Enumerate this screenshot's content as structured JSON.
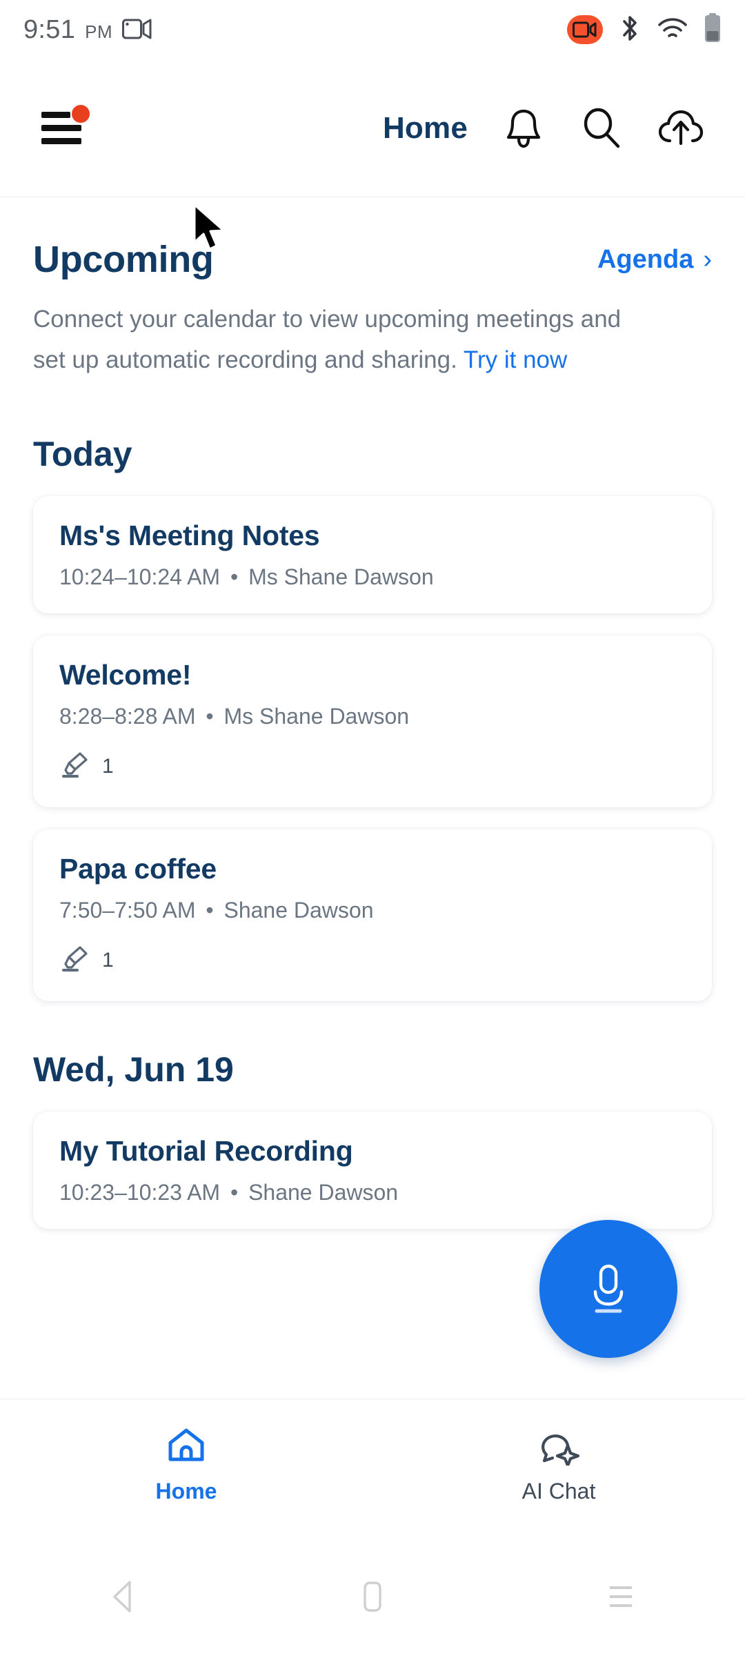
{
  "status_bar": {
    "time": "9:51",
    "ampm": "PM",
    "icons": [
      "screen-record-icon",
      "recording-active-icon",
      "bluetooth-icon",
      "wifi-icon",
      "battery-icon"
    ]
  },
  "header": {
    "title": "Home",
    "menu_icon": "hamburger-menu-icon",
    "has_notification_dot": true,
    "actions": [
      "bell-icon",
      "search-icon",
      "cloud-upload-icon"
    ]
  },
  "upcoming": {
    "heading": "Upcoming",
    "agenda_label": "Agenda",
    "agenda_chevron": "›",
    "blurb_text": "Connect your calendar to view upcoming meetings and set up automatic recording and sharing. ",
    "blurb_link": "Try it now"
  },
  "sections": [
    {
      "heading": "Today",
      "items": [
        {
          "title": "Ms's Meeting Notes",
          "time": "10:24–10:24 AM",
          "separator": "•",
          "owner": "Ms Shane Dawson",
          "has_meta": false,
          "meta_icon": "highlighter-icon",
          "meta_count": ""
        },
        {
          "title": "Welcome!",
          "time": "8:28–8:28 AM",
          "separator": "•",
          "owner": "Ms Shane Dawson",
          "has_meta": true,
          "meta_icon": "highlighter-icon",
          "meta_count": "1"
        },
        {
          "title": "Papa coffee",
          "time": "7:50–7:50 AM",
          "separator": "•",
          "owner": "Shane Dawson",
          "has_meta": true,
          "meta_icon": "highlighter-icon",
          "meta_count": "1"
        }
      ]
    },
    {
      "heading": "Wed, Jun 19",
      "items": [
        {
          "title": "My Tutorial Recording",
          "time": "10:23–10:23 AM",
          "separator": "•",
          "owner": "Shane Dawson",
          "has_meta": false,
          "meta_icon": "highlighter-icon",
          "meta_count": ""
        }
      ]
    }
  ],
  "fab": {
    "icon": "microphone-icon"
  },
  "tabs": [
    {
      "label": "Home",
      "icon": "home-icon",
      "active": true
    },
    {
      "label": "AI Chat",
      "icon": "ai-chat-icon",
      "active": false
    }
  ],
  "android_nav": {
    "back": "back-triangle-icon",
    "home": "home-square-icon",
    "recents": "recents-lines-icon"
  },
  "colors": {
    "accent_blue": "#1572e8",
    "navy": "#123a63",
    "muted_gray": "#6b7682",
    "record_red": "#f4512c",
    "dot_red": "#e8401f"
  }
}
